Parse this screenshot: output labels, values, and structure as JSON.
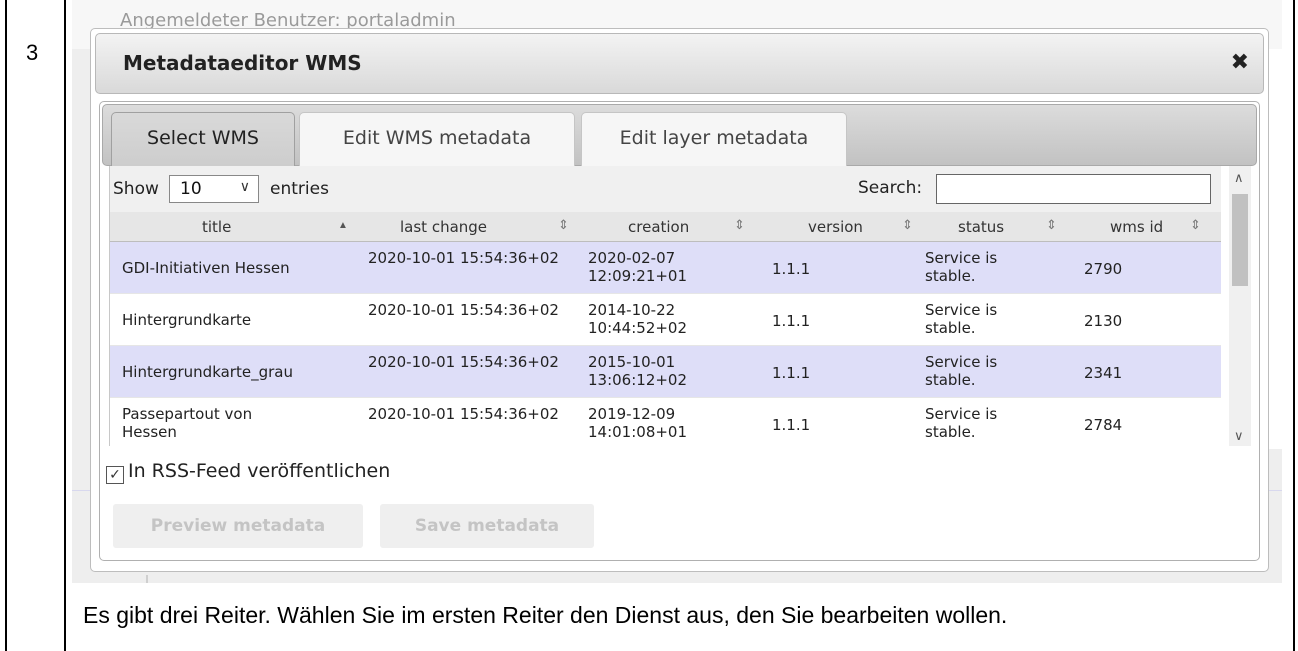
{
  "doc": {
    "row_number": "3",
    "caption": "Es gibt drei Reiter. Wählen Sie im ersten Reiter den Dienst aus, den Sie bearbeiten wollen."
  },
  "background": {
    "logged_in_text": "Angemeldeter Benutzer: portaladmin"
  },
  "dialog": {
    "title": "Metadataeditor WMS",
    "close_glyph": "✖",
    "tabs": [
      {
        "label": "Select WMS",
        "active": true
      },
      {
        "label": "Edit WMS metadata",
        "active": false
      },
      {
        "label": "Edit layer metadata",
        "active": false
      }
    ],
    "table": {
      "show_label": "Show",
      "page_size": "10",
      "entries_label": "entries",
      "search_label": "Search:",
      "search_value": "",
      "columns": [
        "title",
        "last change",
        "creation",
        "version",
        "status",
        "wms id"
      ],
      "rows": [
        {
          "title": "GDI-Initiativen Hessen",
          "last_change": "2020-10-01 15:54:36+02",
          "creation": "2020-02-07 12:09:21+01",
          "version": "1.1.1",
          "status": "Service is stable.",
          "wms_id": "2790"
        },
        {
          "title": "Hintergrundkarte",
          "last_change": "2020-10-01 15:54:36+02",
          "creation": "2014-10-22 10:44:52+02",
          "version": "1.1.1",
          "status": "Service is stable.",
          "wms_id": "2130"
        },
        {
          "title": "Hintergrundkarte_grau",
          "last_change": "2020-10-01 15:54:36+02",
          "creation": "2015-10-01 13:06:12+02",
          "version": "1.1.1",
          "status": "Service is stable.",
          "wms_id": "2341"
        },
        {
          "title": "Passepartout von Hessen",
          "last_change": "2020-10-01 15:54:36+02",
          "creation": "2019-12-09 14:01:08+01",
          "version": "1.1.1",
          "status": "Service is stable.",
          "wms_id": "2784"
        }
      ]
    },
    "rss_checkbox": {
      "label": "In RSS-Feed veröffentlichen",
      "checked": true
    },
    "buttons": {
      "preview": "Preview metadata",
      "save": "Save metadata"
    }
  }
}
